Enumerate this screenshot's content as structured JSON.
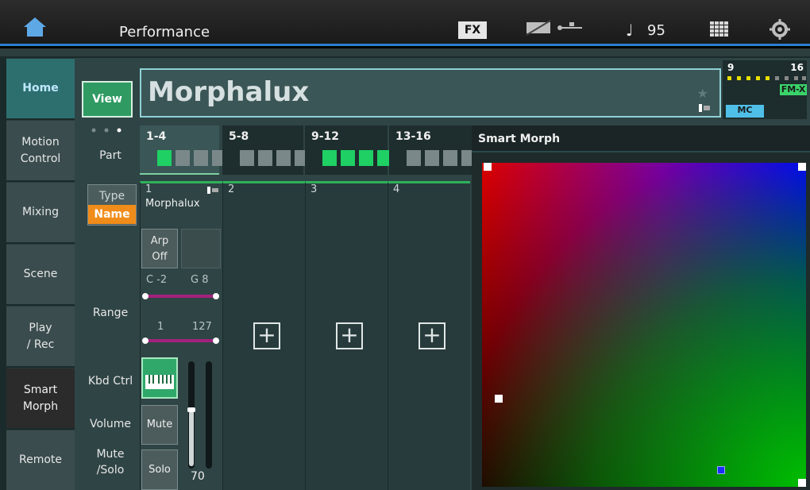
{
  "top_bar": {
    "title": "Performance",
    "fx_label": "FX",
    "tempo": "95"
  },
  "sidebar": {
    "items": [
      {
        "label": "Home"
      },
      {
        "label": "Motion\nControl"
      },
      {
        "label": "Mixing"
      },
      {
        "label": "Scene"
      },
      {
        "label": "Play\n/ Rec"
      },
      {
        "label": "Smart\nMorph"
      },
      {
        "label": "Remote"
      }
    ]
  },
  "view_button": "View",
  "performance_name": "Morphalux",
  "meter": {
    "start_label": "9",
    "end_label": "16",
    "badge_fm": "FM-X",
    "badge_mc": "MC"
  },
  "part_tabs": [
    {
      "label": "1-4",
      "squares": [
        true,
        false,
        false,
        false
      ]
    },
    {
      "label": "5-8",
      "squares": [
        false,
        false,
        false,
        false
      ]
    },
    {
      "label": "9-12",
      "squares": [
        true,
        true,
        true,
        true
      ]
    },
    {
      "label": "13-16",
      "squares": [
        false,
        false,
        false,
        false
      ]
    }
  ],
  "row_labels": {
    "part": "Part",
    "type_name": {
      "type": "Type",
      "name": "Name"
    },
    "range": "Range",
    "kbd_ctrl": "Kbd Ctrl",
    "volume": "Volume",
    "mute_solo": "Mute\n/Solo"
  },
  "parts": [
    {
      "number": "1",
      "name": "Morphalux"
    },
    {
      "number": "2"
    },
    {
      "number": "3"
    },
    {
      "number": "4"
    }
  ],
  "arp": {
    "label": "Arp",
    "state": "Off"
  },
  "note_range": {
    "low": "C -2",
    "high": "G 8"
  },
  "velocity_range": {
    "low": "1",
    "high": "127"
  },
  "mute_label": "Mute",
  "solo_label": "Solo",
  "volume_value": "70",
  "smart_morph": {
    "title": "Smart Morph"
  }
}
